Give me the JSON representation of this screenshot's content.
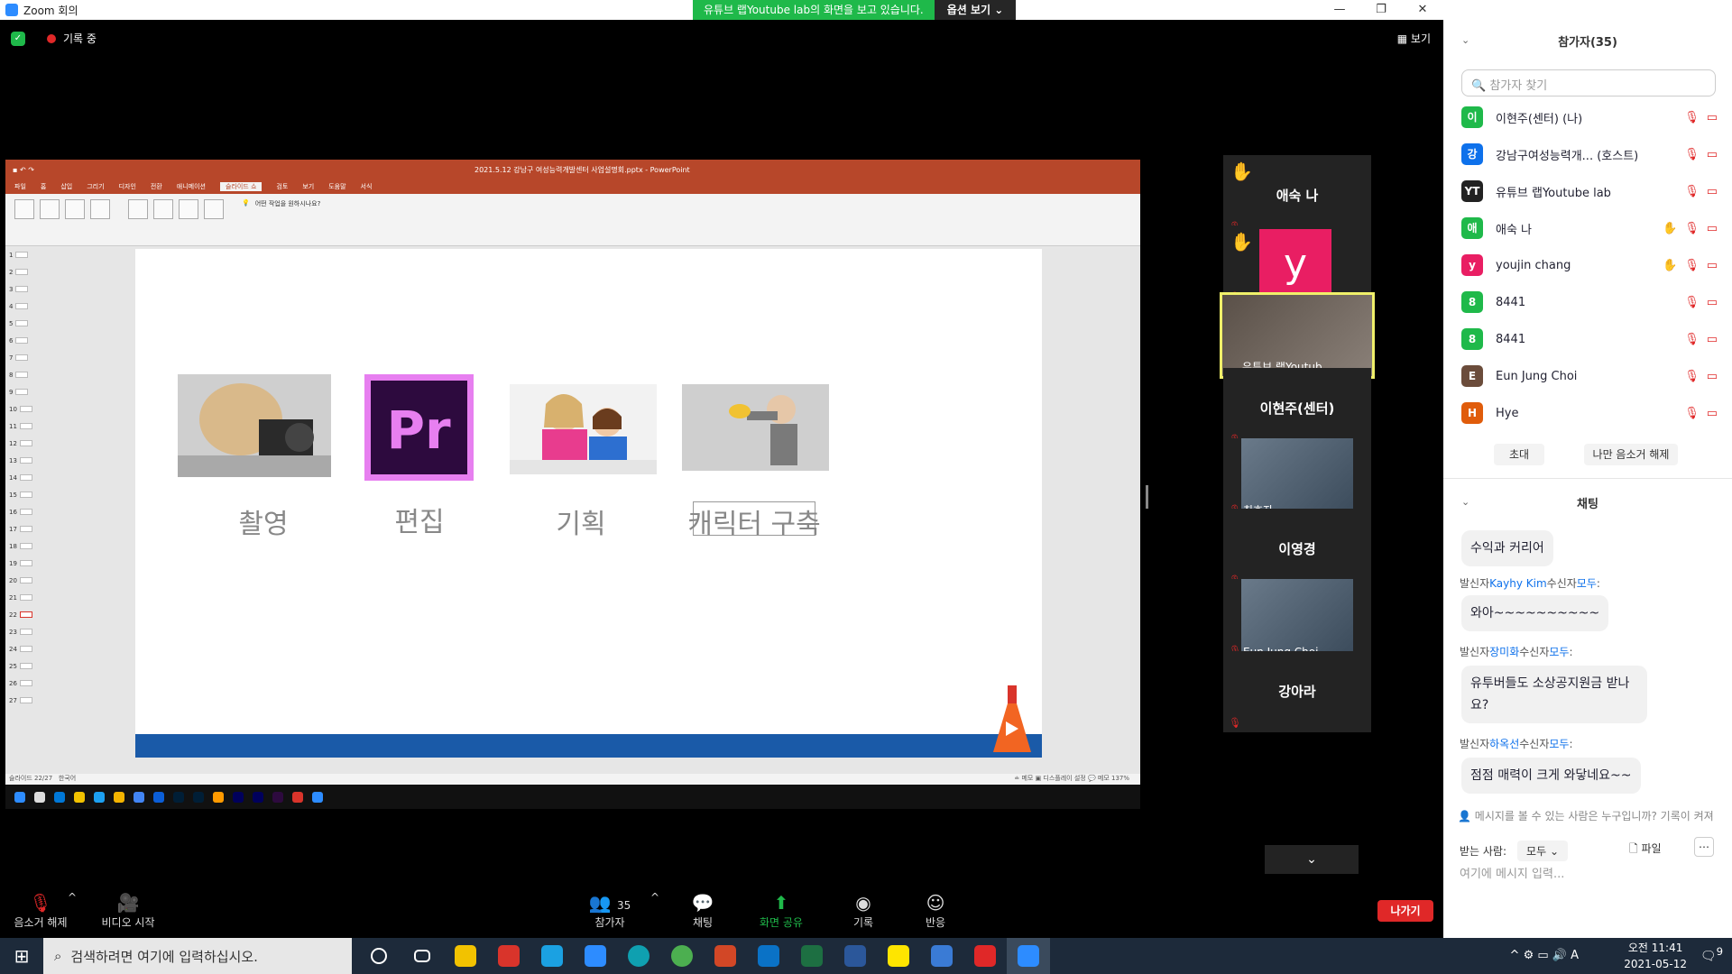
{
  "window": {
    "title": "Zoom 회의",
    "minimize": "—",
    "maximize": "❐",
    "close": "✕"
  },
  "share_banner": {
    "message": "유튜브 랩Youtube lab의 화면을 보고 있습니다.",
    "options": "옵션 보기 ⌄"
  },
  "recording": {
    "label": "기록 중"
  },
  "view_button": "보기",
  "ppt": {
    "file_title": "2021.5.12 강남구 여성능력개발센터 사업설명회.pptx - PowerPoint",
    "tabs": [
      "파일",
      "홈",
      "삽입",
      "그리기",
      "디자인",
      "전환",
      "애니메이션",
      "슬라이드 쇼",
      "검토",
      "보기",
      "도움말",
      "서식"
    ],
    "active_tab": "슬라이드 쇼",
    "tell_me": "어떤 작업을 원하시나요?",
    "status_left": "슬라이드 22/27",
    "status_lang": "한국어",
    "status_right": "≐ 메모   ▣ 디스플레이 설정   💬 메모        137%",
    "slide_captions": [
      "촬영",
      "편집",
      "기획",
      "캐릭터 구축"
    ],
    "thumb_numbers": [
      "1",
      "2",
      "3",
      "4",
      "5",
      "6",
      "7",
      "8",
      "9",
      "10",
      "11",
      "12",
      "13",
      "14",
      "15",
      "16",
      "17",
      "18",
      "19",
      "20",
      "21",
      "22",
      "23",
      "24",
      "25",
      "26",
      "27"
    ]
  },
  "videos": [
    {
      "name": "애숙 나",
      "hand": true,
      "type": "name"
    },
    {
      "name": "youjin chang",
      "hand": true,
      "type": "avatar",
      "initial": "y"
    },
    {
      "name": "유튜브 랩Youtub...",
      "type": "video",
      "active": true
    },
    {
      "name": "이현주(센터)",
      "type": "name"
    },
    {
      "name": "최효자",
      "type": "video"
    },
    {
      "name": "이영경",
      "type": "name"
    },
    {
      "name": "Eun Jung Choi",
      "type": "video"
    },
    {
      "name": "강아라",
      "type": "name"
    }
  ],
  "toolbar": {
    "unmute": "음소거 해제",
    "video": "비디오 시작",
    "participants": "참가자",
    "participants_count": "35",
    "chat": "채팅",
    "share": "화면 공유",
    "record": "기록",
    "reactions": "반응",
    "leave": "나가기"
  },
  "participants_panel": {
    "title": "참가자(35)",
    "search_placeholder": "참가자 찾기",
    "people": [
      {
        "initial": "이",
        "color": "#1fb94a",
        "name": "이현주(센터) (나)"
      },
      {
        "initial": "강",
        "color": "#0e71eb",
        "name": "강남구여성능력개...  (호스트)"
      },
      {
        "initial": "YT",
        "color": "#222222",
        "name": "유튜브 랩Youtube lab"
      },
      {
        "initial": "애",
        "color": "#1fb94a",
        "name": "애숙 나",
        "hand": true
      },
      {
        "initial": "y",
        "color": "#e91e63",
        "name": "youjin chang",
        "hand": true
      },
      {
        "initial": "8",
        "color": "#1fb94a",
        "name": "8441"
      },
      {
        "initial": "8",
        "color": "#1fb94a",
        "name": "8441"
      },
      {
        "initial": "E",
        "color": "#6b4c3b",
        "name": "Eun Jung Choi"
      },
      {
        "initial": "H",
        "color": "#e05c0b",
        "name": "Hye"
      }
    ],
    "invite": "초대",
    "unmute_me": "나만 음소거 해제"
  },
  "chat_panel": {
    "title": "채팅",
    "messages": [
      {
        "text": "수익과 커리어"
      },
      {
        "sender": "Kayhy Kim",
        "to": "모두",
        "text": "와아~~~~~~~~~~"
      },
      {
        "sender": "장미화",
        "to": "모두",
        "text": "유투버들도 소상공지원금 받나요?"
      },
      {
        "sender": "하옥선",
        "to": "모두",
        "text": "점점 매력이 크게 와닿네요~~"
      }
    ],
    "from_label": "발신자",
    "to_label": "수신자",
    "hint": "메시지를 볼 수 있는 사람은 누구입니까? 기록이 켜져",
    "to_prefix": "받는 사람:",
    "to_value": "모두",
    "file": "파일",
    "input_placeholder": "여기에 메시지 입력..."
  },
  "taskbar": {
    "search": "검색하려면 여기에 입력하십시오.",
    "time": "오전 11:41",
    "date": "2021-05-12",
    "ime": "A",
    "notif_count": "9"
  },
  "colors": {
    "zoom_blue": "#2d8cff",
    "green": "#1fb94a",
    "red": "#e02828",
    "ppt_red": "#b7472a"
  }
}
